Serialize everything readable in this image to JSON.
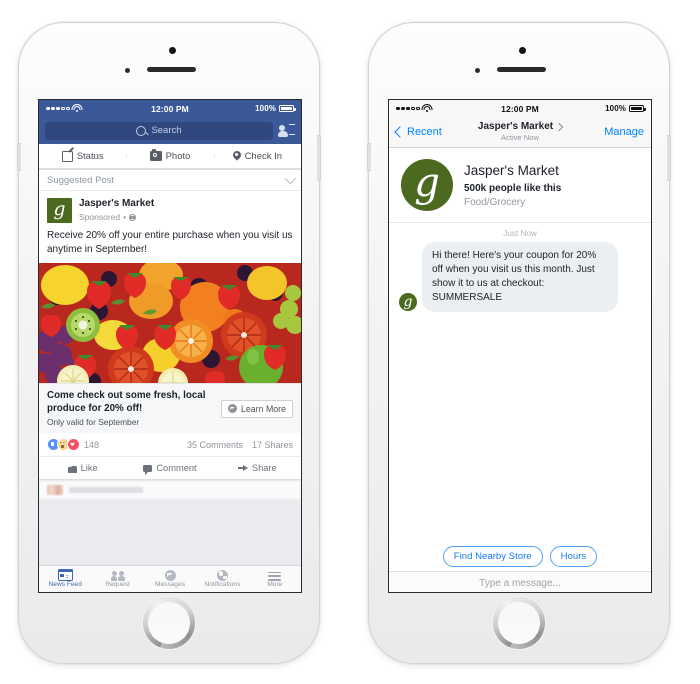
{
  "left_phone": {
    "status_bar": {
      "time": "12:00 PM",
      "battery": "100%",
      "carrier_dots": 5,
      "carrier_filled": 3
    },
    "header": {
      "search_placeholder": "Search",
      "search_icon": "search-icon",
      "requests_icon": "friend-requests-icon"
    },
    "composer_actions": [
      {
        "label": "Status",
        "icon": "status-compose-icon"
      },
      {
        "label": "Photo",
        "icon": "camera-icon"
      },
      {
        "label": "Check In",
        "icon": "location-pin-icon"
      }
    ],
    "post": {
      "suggested_label": "Suggested Post",
      "collapse_icon": "chevron-down-icon",
      "page_name": "Jasper's Market",
      "sponsored_label": "Sponsored",
      "privacy_icon": "globe-icon",
      "body": "Receive 20% off your entire purchase when you visit us anytime in September!",
      "image_alt": "assorted fresh fruit collage",
      "link_title": "Come check out some fresh, local produce for 20% off!",
      "link_subtitle": "Only valid for September",
      "cta_label": "Learn More",
      "cta_icon": "messenger-icon",
      "reactions_count": "148",
      "reaction_icons": [
        "like-reaction",
        "wow-reaction",
        "love-reaction"
      ],
      "comments_count": "35 Comments",
      "shares_count": "17 Shares",
      "footer_actions": [
        {
          "label": "Like",
          "icon": "thumbs-up-icon"
        },
        {
          "label": "Comment",
          "icon": "comment-bubble-icon"
        },
        {
          "label": "Share",
          "icon": "share-arrow-icon"
        }
      ]
    },
    "tab_bar": [
      {
        "label": "News Feed",
        "icon": "news-feed-icon",
        "active": true
      },
      {
        "label": "Request",
        "icon": "friend-requests-icon",
        "active": false
      },
      {
        "label": "Messages",
        "icon": "messenger-icon",
        "active": false
      },
      {
        "label": "Notifications",
        "icon": "globe-notifications-icon",
        "active": false
      },
      {
        "label": "More",
        "icon": "hamburger-menu-icon",
        "active": false
      }
    ]
  },
  "right_phone": {
    "status_bar": {
      "time": "12:00 PM",
      "battery": "100%"
    },
    "nav": {
      "back_label": "Recent",
      "back_icon": "chevron-left-icon",
      "title": "Jasper's Market",
      "title_chevron_icon": "chevron-right-icon",
      "subtitle": "Active Now",
      "action_label": "Manage"
    },
    "business": {
      "name": "Jasper's Market",
      "likes": "500k people like this",
      "category": "Food/Grocery",
      "avatar_icon": "jaspers-market-logo"
    },
    "thread": {
      "timestamp": "Just Now",
      "messages": [
        {
          "sender": "Jasper's Market",
          "avatar_icon": "jaspers-market-logo",
          "text": "Hi there! Here's your coupon for 20% off when you visit us this month. Just show it to us at checkout: SUMMERSALE"
        }
      ]
    },
    "quick_replies": [
      {
        "label": "Find Nearby Store"
      },
      {
        "label": "Hours"
      }
    ],
    "composer": {
      "placeholder": "Type a message..."
    }
  },
  "brand_colors": {
    "facebook_blue": "#3b5998",
    "search_field": "#31487f",
    "messenger_blue": "#0084ff",
    "quick_reply_blue": "#1878f3",
    "jaspers_green": "#4b6a20",
    "feed_background": "#e9ebee"
  }
}
